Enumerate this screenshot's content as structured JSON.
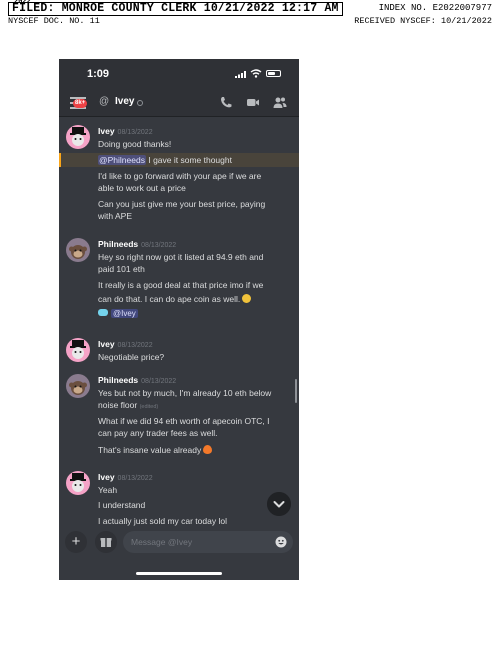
{
  "filing": {
    "filed_line": "FILED: MONROE COUNTY CLERK 10/21/2022 12:17 AM",
    "overlap_small": "2022",
    "index_label": "INDEX NO. E2022007977",
    "doc_no": "NYSCEF DOC. NO. 11",
    "received": "RECEIVED NYSCEF: 10/21/2022"
  },
  "phone": {
    "time": "1:09",
    "badge": "8k+",
    "channel_prefix": "@",
    "channel_name": "Ivey"
  },
  "messages": [
    {
      "user": "Ivey",
      "date": "08/13/2022",
      "lines": [
        "Doing good thanks!",
        "I gave it some thought",
        "I'd like to go forward with your ape if we are",
        "able to work out a price",
        "Can you just give me your best price, paying",
        "with APE"
      ],
      "mention": "@Philneeds"
    },
    {
      "user": "Philneeds",
      "date": "08/13/2022",
      "lines": [
        "Hey so right now got it listed at 94.9 eth and",
        "paid 101 eth",
        "It really is a good deal at that price imo if we",
        "can do that. I can do ape coin as well."
      ],
      "mention": "@Ivey"
    },
    {
      "user": "Ivey",
      "date": "08/13/2022",
      "lines": [
        "Negotiable price?"
      ]
    },
    {
      "user": "Philneeds",
      "date": "08/13/2022",
      "lines": [
        "Yes but not by much, I'm already 10 eth below",
        "noise floor",
        "What if we did 94 eth worth of apecoin OTC, I",
        "can pay any trader fees as well.",
        "That's insane value already"
      ],
      "edited": "(edited)"
    },
    {
      "user": "Ivey",
      "date": "08/13/2022",
      "lines": [
        "Yeah",
        "I understand",
        "I actually just sold my car today lol"
      ]
    }
  ],
  "composer": {
    "plus": "+",
    "placeholder": "Message @Ivey"
  },
  "colors": {
    "background": "#36393f",
    "header": "#2f3136",
    "mention_highlight": "#faa61a",
    "badge": "#ed4245",
    "blurple": "#5865f2"
  },
  "icons": [
    "back-icon",
    "at-icon",
    "call-icon",
    "video-icon",
    "members-icon",
    "plus-icon",
    "gift-icon",
    "emoji-icon",
    "chevron-down-icon"
  ]
}
